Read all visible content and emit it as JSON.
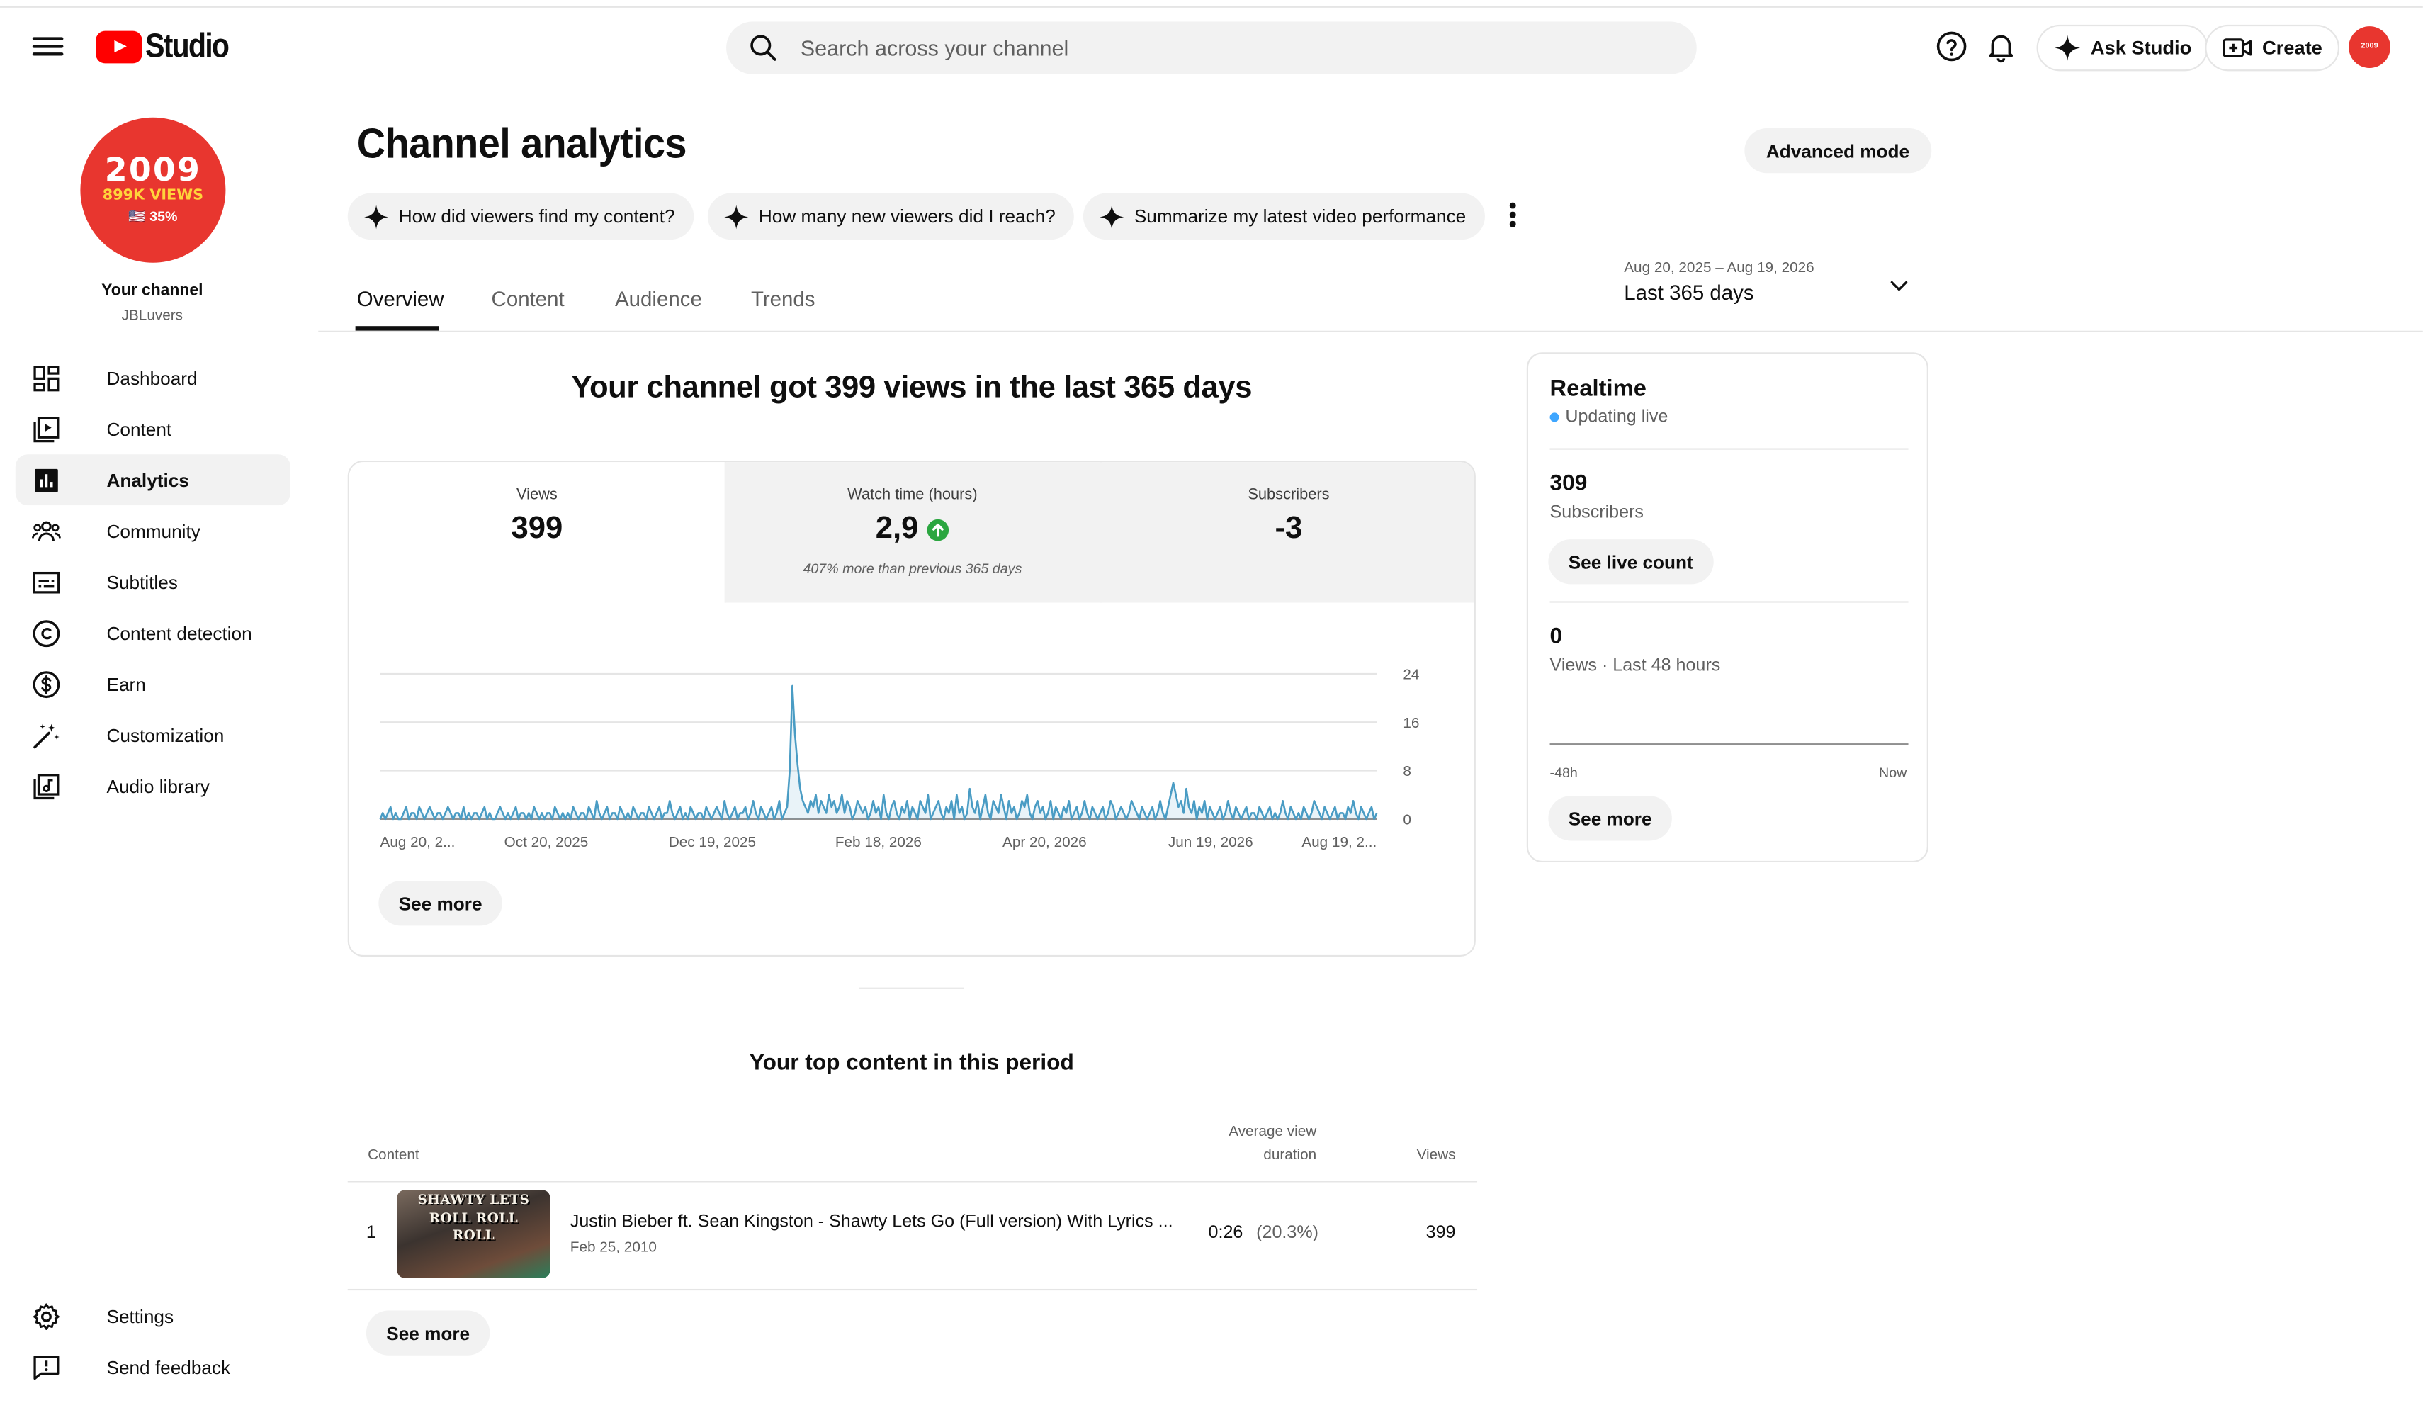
{
  "header": {
    "logo_text": "Studio",
    "search_placeholder": "Search across your channel",
    "ask_studio": "Ask Studio",
    "create": "Create",
    "avatar_text": "2009"
  },
  "channel": {
    "avatar_line1": "2009",
    "avatar_line2": "899K VIEWS",
    "avatar_line3": "🇺🇸 35%",
    "label": "Your channel",
    "handle": "JBLuvers"
  },
  "sidebar": {
    "items": [
      {
        "label": "Dashboard",
        "icon": "dashboard-icon"
      },
      {
        "label": "Content",
        "icon": "content-icon"
      },
      {
        "label": "Analytics",
        "icon": "analytics-icon",
        "active": true
      },
      {
        "label": "Community",
        "icon": "community-icon"
      },
      {
        "label": "Subtitles",
        "icon": "subtitles-icon"
      },
      {
        "label": "Content detection",
        "icon": "copyright-icon"
      },
      {
        "label": "Earn",
        "icon": "dollar-icon"
      },
      {
        "label": "Customization",
        "icon": "magic-wand-icon"
      },
      {
        "label": "Audio library",
        "icon": "audio-library-icon"
      }
    ],
    "bottom": [
      {
        "label": "Settings",
        "icon": "gear-icon"
      },
      {
        "label": "Send feedback",
        "icon": "feedback-icon"
      }
    ]
  },
  "main": {
    "title": "Channel analytics",
    "advanced_mode": "Advanced mode",
    "chips": [
      "How did viewers find my content?",
      "How many new viewers did I reach?",
      "Summarize my latest video performance"
    ],
    "tabs": [
      "Overview",
      "Content",
      "Audience",
      "Trends"
    ],
    "active_tab": "Overview",
    "date_range": {
      "dates": "Aug 20, 2025 – Aug 19, 2026",
      "label": "Last 365 days"
    },
    "headline": "Your channel got 399 views in the last 365 days",
    "metrics": [
      {
        "label": "Views",
        "value": "399",
        "sub": ""
      },
      {
        "label": "Watch time (hours)",
        "value": "2,9",
        "sub": "407% more than previous 365 days"
      },
      {
        "label": "Subscribers",
        "value": "-3",
        "sub": ""
      }
    ],
    "see_more": "See more"
  },
  "chart_data": {
    "type": "area",
    "title": "",
    "xlabel": "",
    "ylabel": "",
    "ylim": [
      0,
      24
    ],
    "yticks": [
      0,
      8,
      16,
      24
    ],
    "x_tick_labels": [
      "Aug 20, 2...",
      "Oct 20, 2025",
      "Dec 19, 2025",
      "Feb 18, 2026",
      "Apr 20, 2026",
      "Jun 19, 2026",
      "Aug 19, 2..."
    ],
    "color": "#4a9cc4",
    "grid": true,
    "series": [
      {
        "values": [
          0,
          1,
          0,
          1,
          2,
          0,
          1,
          0,
          0,
          1,
          2,
          0,
          1,
          1,
          0,
          2,
          1,
          0,
          1,
          2,
          1,
          0,
          1,
          1,
          0,
          1,
          2,
          1,
          0,
          1,
          1,
          0,
          2,
          0,
          1,
          0,
          1,
          1,
          0,
          1,
          2,
          0,
          1,
          0,
          0,
          1,
          2,
          1,
          0,
          1,
          0,
          1,
          2,
          0,
          1,
          1,
          0,
          1,
          0,
          2,
          1,
          0,
          1,
          0,
          1,
          1,
          0,
          2,
          1,
          0,
          1,
          0,
          1,
          0,
          2,
          1,
          0,
          1,
          1,
          0,
          2,
          1,
          0,
          3,
          1,
          0,
          1,
          2,
          0,
          1,
          1,
          0,
          2,
          1,
          0,
          1,
          0,
          2,
          1,
          0,
          1,
          1,
          0,
          2,
          1,
          0,
          1,
          2,
          0,
          1,
          1,
          3,
          1,
          0,
          1,
          2,
          0,
          1,
          0,
          2,
          1,
          0,
          1,
          1,
          0,
          2,
          1,
          0,
          1,
          2,
          1,
          0,
          3,
          1,
          0,
          1,
          2,
          0,
          1,
          1,
          2,
          0,
          1,
          3,
          1,
          0,
          2,
          1,
          0,
          1,
          2,
          0,
          1,
          3,
          0,
          1,
          2,
          8,
          22,
          14,
          9,
          5,
          3,
          2,
          1,
          3,
          2,
          4,
          1,
          3,
          2,
          1,
          4,
          2,
          3,
          1,
          2,
          4,
          1,
          3,
          2,
          0,
          1,
          3,
          2,
          1,
          2,
          0,
          1,
          3,
          1,
          2,
          0,
          4,
          1,
          0,
          2,
          3,
          1,
          0,
          2,
          1,
          3,
          0,
          2,
          1,
          0,
          3,
          2,
          1,
          4,
          0,
          1,
          2,
          3,
          1,
          0,
          2,
          1,
          3,
          0,
          4,
          1,
          2,
          0,
          1,
          5,
          2,
          1,
          3,
          0,
          2,
          4,
          1,
          0,
          3,
          2,
          1,
          4,
          2,
          0,
          3,
          1,
          2,
          0,
          1,
          3,
          2,
          4,
          1,
          0,
          2,
          3,
          1,
          2,
          0,
          1,
          3,
          0,
          2,
          1,
          0,
          2,
          1,
          3,
          0,
          1,
          2,
          0,
          1,
          3,
          1,
          0,
          2,
          1,
          0,
          1,
          2,
          0,
          1,
          3,
          2,
          0,
          1,
          2,
          1,
          0,
          1,
          3,
          2,
          1,
          0,
          2,
          1,
          0,
          1,
          2,
          0,
          1,
          3,
          1,
          0,
          2,
          4,
          6,
          4,
          2,
          3,
          1,
          5,
          2,
          1,
          3,
          0,
          2,
          1,
          3,
          0,
          2,
          1,
          0,
          1,
          2,
          0,
          1,
          3,
          1,
          0,
          2,
          1,
          0,
          1,
          2,
          0,
          1,
          1,
          0,
          2,
          1,
          0,
          1,
          2,
          0,
          1,
          0,
          1,
          3,
          1,
          0,
          2,
          1,
          0,
          1,
          0,
          2,
          1,
          0,
          1,
          3,
          2,
          1,
          0,
          2,
          1,
          0,
          1,
          2,
          0,
          1,
          1,
          0,
          2,
          1,
          3,
          1,
          0,
          2,
          1,
          0,
          1,
          2,
          0,
          1
        ]
      }
    ]
  },
  "top_content": {
    "title": "Your top content in this period",
    "col_content": "Content",
    "col_avd_1": "Average view",
    "col_avd_2": "duration",
    "col_views": "Views",
    "rows": [
      {
        "rank": "1",
        "thumb_line1": "SHAWTY LETS",
        "thumb_line2": "ROLL ROLL",
        "thumb_line3": "ROLL",
        "title": "Justin Bieber ft. Sean Kingston - Shawty Lets Go (Full version) With Lyrics ...",
        "date": "Feb 25, 2010",
        "avd": "0:26",
        "avd_pct": "(20.3%)",
        "views": "399"
      }
    ],
    "see_more": "See more"
  },
  "realtime": {
    "title": "Realtime",
    "live": "Updating live",
    "subs_value": "309",
    "subs_label": "Subscribers",
    "see_live": "See live count",
    "views_value": "0",
    "views_label": "Views · Last 48 hours",
    "axis_start": "-48h",
    "axis_end": "Now",
    "see_more": "See more"
  }
}
